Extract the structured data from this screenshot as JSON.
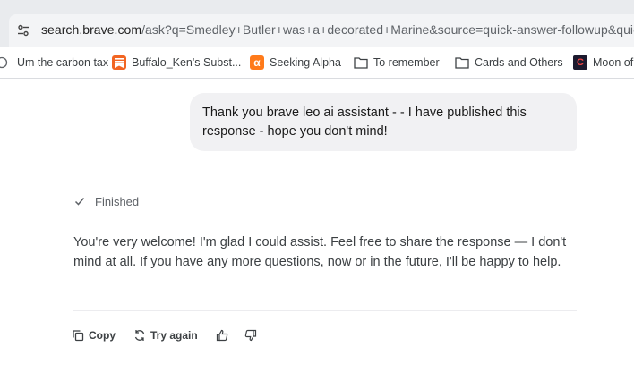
{
  "address_bar": {
    "host": "search.brave.com",
    "path": "/ask?q=Smedley+Butler+was+a+decorated+Marine&source=quick-answer-followup&quick"
  },
  "bookmarks": [
    {
      "label": "Um the carbon tax",
      "icon": "truncated-favicon-icon"
    },
    {
      "label": "Buffalo_Ken's Subst...",
      "icon": "substack-icon"
    },
    {
      "label": "Seeking Alpha",
      "icon": "seeking-alpha-icon",
      "glyph": "α"
    },
    {
      "label": "To remember",
      "icon": "folder-icon"
    },
    {
      "label": "Cards and Others",
      "icon": "folder-icon"
    },
    {
      "label": "Moon of",
      "icon": "moon-of-alabama-icon",
      "glyph": "C"
    }
  ],
  "conversation": {
    "user_message": "Thank you brave leo ai assistant - - I have published this response - hope you don't mind!",
    "status": "Finished",
    "assistant_message": "You're very welcome! I'm glad I could assist. Feel free to share the response — I don't mind at all. If you have any more questions, now or in the future, I'll be happy to help."
  },
  "actions": {
    "copy_label": "Copy",
    "try_again_label": "Try again"
  },
  "colors": {
    "browser_chrome": "#e9ebee",
    "user_bubble": "#f1f1f3",
    "substack_orange": "#f26522",
    "seeking_alpha_orange": "#ff7a1a"
  }
}
